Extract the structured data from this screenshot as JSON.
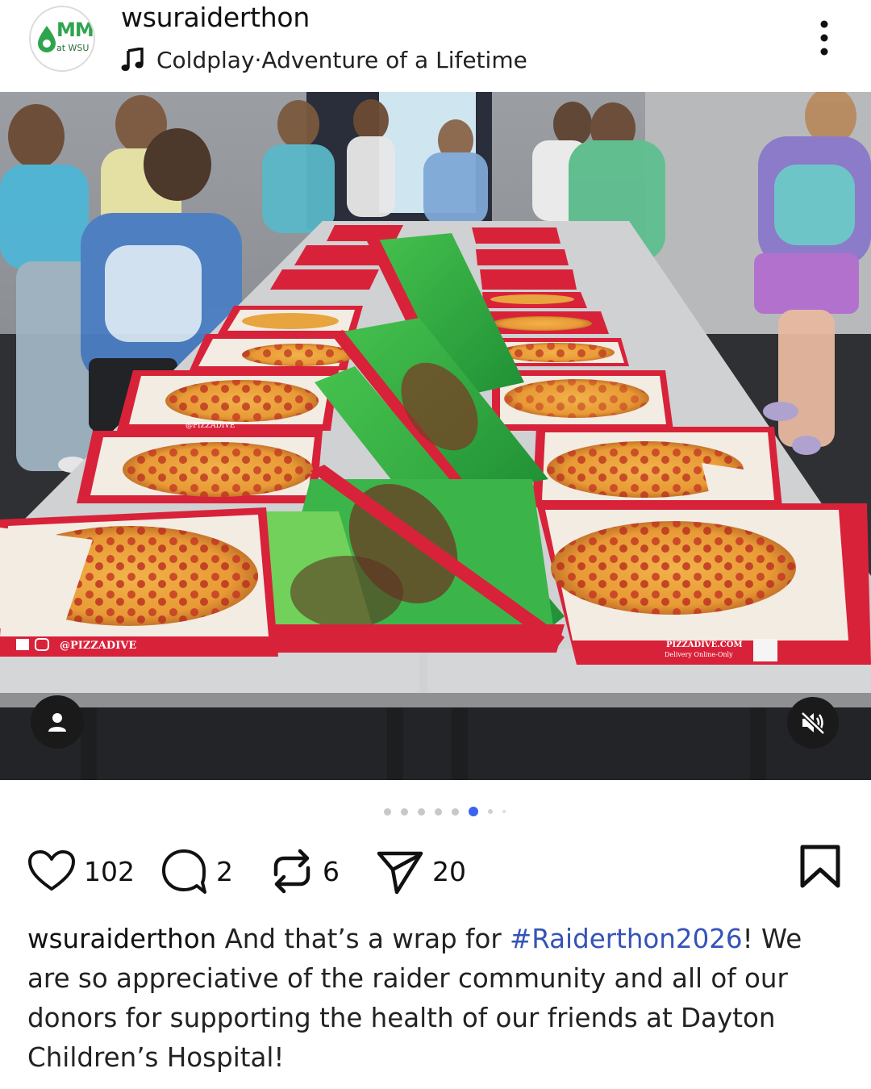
{
  "post": {
    "username": "wsuraiderthon",
    "avatar": {
      "logo_text": "MM",
      "logo_subtext": "at WSU"
    },
    "music": {
      "artist": "Coldplay",
      "separator": " · ",
      "song": "Adventure of a Lifetime"
    },
    "carousel": {
      "total_dots": 8,
      "active_index": 5
    },
    "actions": {
      "likes": "102",
      "comments": "2",
      "reposts": "6",
      "shares": "20"
    },
    "caption": {
      "username": "wsuraiderthon",
      "text_before": " And that’s a wrap for ",
      "hashtag": "#Raiderthon2026",
      "text_after": "! We are so appreciative of the raider community and all of our donors for supporting the health of our friends at Dayton Children’s Hospital!"
    },
    "photo_texts": {
      "box_handle": "@PIZZADIVE",
      "box_site": "PIZZADIVE.COM",
      "box_delivery": "Delivery Online-Only"
    }
  },
  "colors": {
    "hashtag": "#3553b8",
    "active_dot": "#3b63f0",
    "box_red": "#d8223a",
    "box_green": "#3bb54a",
    "logo_green": "#2fa44f"
  },
  "icons": [
    "more-options-icon",
    "music-note-icon",
    "heart-icon",
    "comment-icon",
    "repost-icon",
    "share-icon",
    "bookmark-icon",
    "user-tag-icon",
    "muted-speaker-icon"
  ]
}
